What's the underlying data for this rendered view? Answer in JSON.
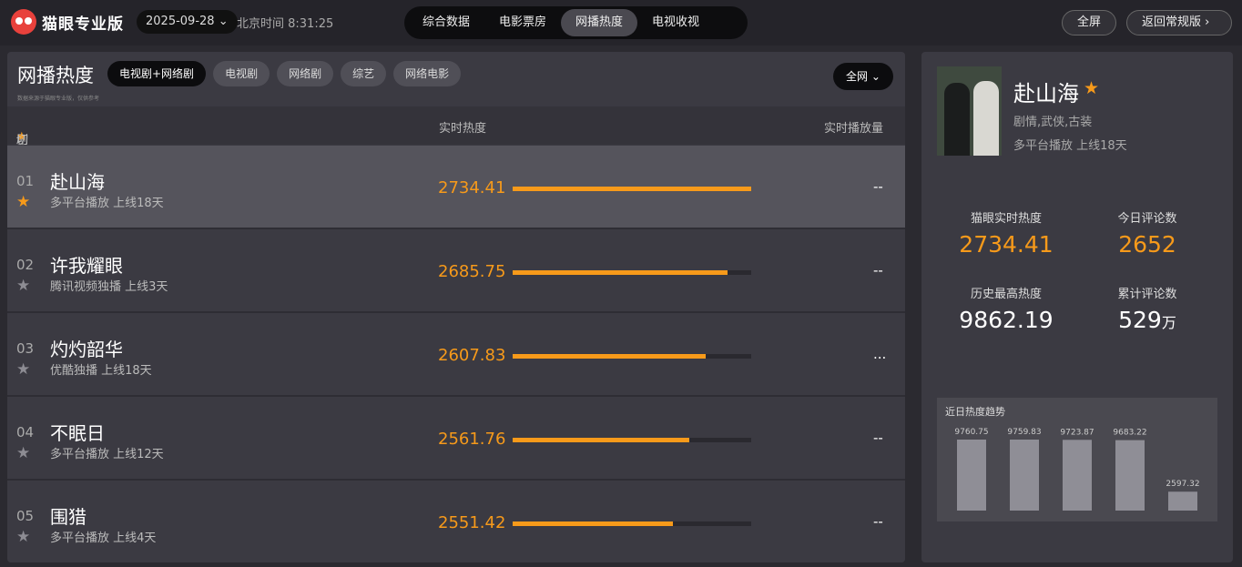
{
  "header": {
    "logo_text": "猫眼专业版",
    "date": "2025-09-28",
    "clock": "北京时间 8:31:25",
    "tabs": [
      {
        "label": "综合数据"
      },
      {
        "label": "电影票房"
      },
      {
        "label": "网播热度"
      },
      {
        "label": "电视收视"
      }
    ],
    "fullscreen_label": "全屏",
    "back_label": "返回常规版"
  },
  "left": {
    "title": "网播热度",
    "note": "数据来源于猫眼专业版，仅供参考",
    "filters": [
      {
        "label": "电视剧+网络剧"
      },
      {
        "label": "电视剧"
      },
      {
        "label": "网络剧"
      },
      {
        "label": "综艺"
      },
      {
        "label": "网络电影"
      }
    ],
    "scope": "全网",
    "columns": {
      "show": "剧集(点击",
      "show_suffix": "切换右侧展示)",
      "heat": "实时热度",
      "plays": "实时播放量"
    },
    "rows": [
      {
        "rank": "01",
        "title": "赴山海",
        "meta": "多平台播放  上线18天",
        "heat": "2734.41",
        "bar": 100,
        "plays": "--"
      },
      {
        "rank": "02",
        "title": "许我耀眼",
        "meta": "腾讯视频独播  上线3天",
        "heat": "2685.75",
        "bar": 90,
        "plays": "--"
      },
      {
        "rank": "03",
        "title": "灼灼韶华",
        "meta": "优酷独播  上线18天",
        "heat": "2607.83",
        "bar": 81,
        "plays": "..."
      },
      {
        "rank": "04",
        "title": "不眠日",
        "meta": "多平台播放  上线12天",
        "heat": "2561.76",
        "bar": 74,
        "plays": "--"
      },
      {
        "rank": "05",
        "title": "围猎",
        "meta": "多平台播放  上线4天",
        "heat": "2551.42",
        "bar": 67,
        "plays": "--"
      }
    ]
  },
  "right": {
    "title": "赴山海",
    "genre": "剧情,武侠,古装",
    "meta": "多平台播放  上线18天",
    "stats": {
      "live_label": "猫眼实时热度",
      "live_value": "2734.41",
      "today_label": "今日评论数",
      "today_value": "2652",
      "peak_label": "历史最高热度",
      "peak_value": "9862.19",
      "total_label": "累计评论数",
      "total_value": "529",
      "total_unit": "万"
    },
    "trend": {
      "title": "近日热度趋势",
      "values": [
        9760.75,
        9759.83,
        9723.87,
        9683.22,
        2597.32
      ],
      "labels": [
        "9760.75",
        "9759.83",
        "9723.87",
        "9683.22",
        "2597.32"
      ]
    }
  },
  "colors": {
    "accent": "#f79a1a",
    "bg": "#2b2a30",
    "panel": "#3b3a42"
  },
  "icons": {
    "star": "star-icon",
    "chevron": "chevron-down-icon"
  }
}
